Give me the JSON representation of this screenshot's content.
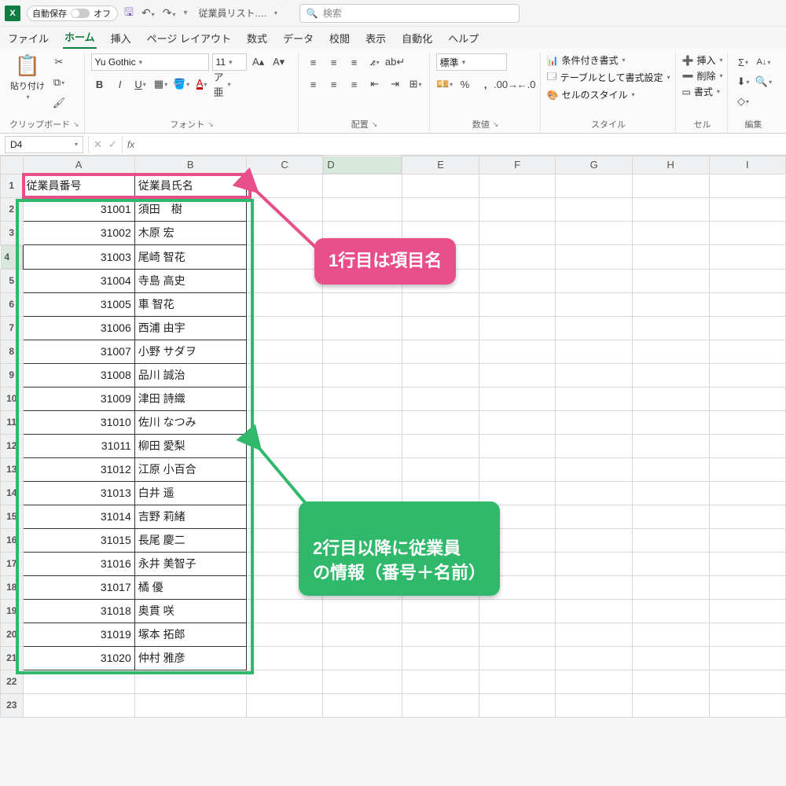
{
  "titlebar": {
    "autosave_label": "自動保存",
    "autosave_state": "オフ",
    "filename": "従業員リスト.…"
  },
  "search": {
    "placeholder": "検索"
  },
  "tabs": {
    "file": "ファイル",
    "home": "ホーム",
    "insert": "挿入",
    "page_layout": "ページ レイアウト",
    "formulas": "数式",
    "data": "データ",
    "review": "校閲",
    "view": "表示",
    "automate": "自動化",
    "help": "ヘルプ"
  },
  "ribbon": {
    "clipboard": {
      "paste": "貼り付け",
      "group": "クリップボード"
    },
    "font": {
      "name": "Yu Gothic",
      "size": "11",
      "group": "フォント"
    },
    "alignment": {
      "group": "配置"
    },
    "number": {
      "style": "標準",
      "group": "数値"
    },
    "styles": {
      "cond": "条件付き書式",
      "table": "テーブルとして書式設定",
      "cell": "セルのスタイル",
      "group": "スタイル"
    },
    "cells": {
      "insert": "挿入",
      "delete": "削除",
      "format": "書式",
      "group": "セル"
    },
    "editing": {
      "group": "編集"
    }
  },
  "formula_bar": {
    "cell": "D4"
  },
  "columns": [
    "A",
    "B",
    "C",
    "D",
    "E",
    "F",
    "G",
    "H",
    "I"
  ],
  "headers": {
    "a": "従業員番号",
    "b": "従業員氏名"
  },
  "rows": [
    {
      "n": 1,
      "id": "",
      "name": ""
    },
    {
      "n": 2,
      "id": "31001",
      "name": "須田　樹"
    },
    {
      "n": 3,
      "id": "31002",
      "name": "木原 宏"
    },
    {
      "n": 4,
      "id": "31003",
      "name": "尾崎 智花"
    },
    {
      "n": 5,
      "id": "31004",
      "name": "寺島 高史"
    },
    {
      "n": 6,
      "id": "31005",
      "name": "車 智花"
    },
    {
      "n": 7,
      "id": "31006",
      "name": "西浦 由宇"
    },
    {
      "n": 8,
      "id": "31007",
      "name": "小野 サダヲ"
    },
    {
      "n": 9,
      "id": "31008",
      "name": "品川 誠治"
    },
    {
      "n": 10,
      "id": "31009",
      "name": "津田 詩織"
    },
    {
      "n": 11,
      "id": "31010",
      "name": "佐川 なつみ"
    },
    {
      "n": 12,
      "id": "31011",
      "name": "柳田 愛梨"
    },
    {
      "n": 13,
      "id": "31012",
      "name": "江原 小百合"
    },
    {
      "n": 14,
      "id": "31013",
      "name": "白井 遥"
    },
    {
      "n": 15,
      "id": "31014",
      "name": "吉野 莉緒"
    },
    {
      "n": 16,
      "id": "31015",
      "name": "長尾 慶二"
    },
    {
      "n": 17,
      "id": "31016",
      "name": "永井 美智子"
    },
    {
      "n": 18,
      "id": "31017",
      "name": "橘 優"
    },
    {
      "n": 19,
      "id": "31018",
      "name": "奥貫 咲"
    },
    {
      "n": 20,
      "id": "31019",
      "name": "塚本 拓郎"
    },
    {
      "n": 21,
      "id": "31020",
      "name": "仲村 雅彦"
    },
    {
      "n": 22,
      "id": "",
      "name": ""
    },
    {
      "n": 23,
      "id": "",
      "name": ""
    }
  ],
  "active_cell": {
    "col": "D",
    "row": 4
  },
  "annotations": {
    "pink": "1行目は項目名",
    "green": "2行目以降に従業員\nの情報（番号＋名前）"
  }
}
